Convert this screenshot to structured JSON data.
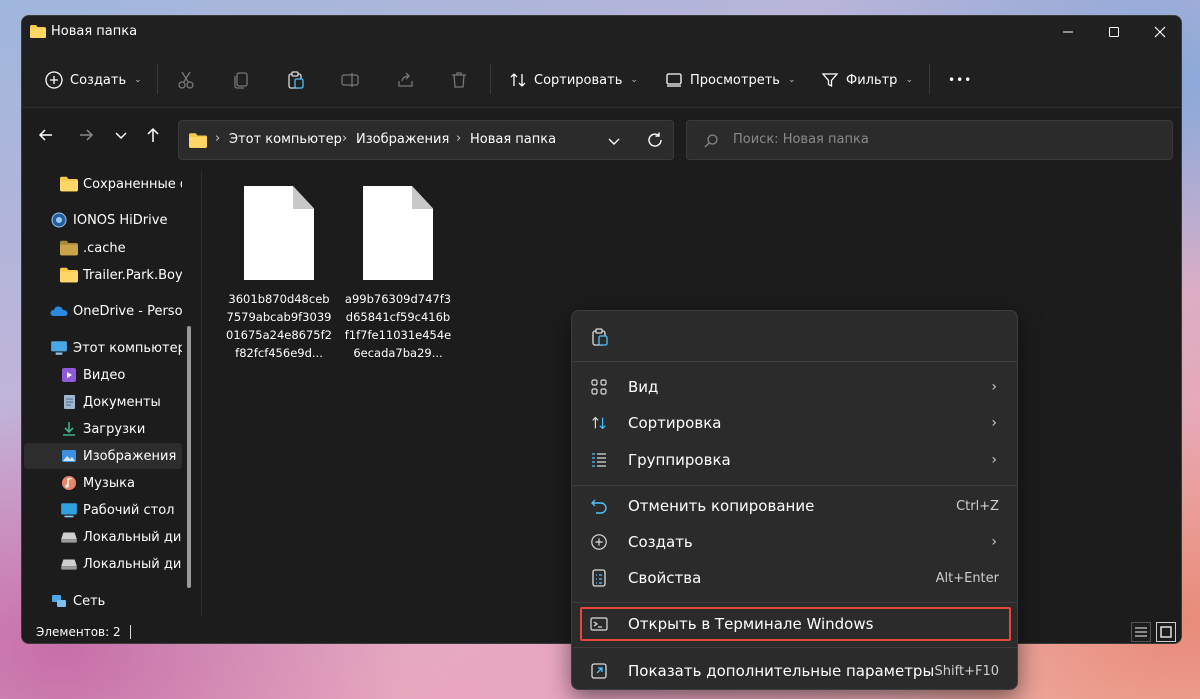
{
  "window": {
    "title": "Новая папка",
    "controls": {
      "minimize": "—",
      "maximize": "☐",
      "close": "✕"
    }
  },
  "toolbar": {
    "create_label": "Создать",
    "sort_label": "Сортировать",
    "view_label": "Просмотреть",
    "filter_label": "Фильтр",
    "more_label": "•••"
  },
  "address": {
    "crumbs": [
      "Этот компьютер",
      "Изображения",
      "Новая папка"
    ],
    "separator": "›"
  },
  "search": {
    "placeholder": "Поиск: Новая папка"
  },
  "sidebar": {
    "items": [
      {
        "label": "Сохраненные ф",
        "icon": "folder-icon"
      },
      {
        "label": "IONOS HiDrive",
        "icon": "cloud-drive-icon"
      },
      {
        "label": ".cache",
        "icon": "folder-icon"
      },
      {
        "label": "Trailer.Park.Boys",
        "icon": "folder-icon"
      },
      {
        "label": "OneDrive - Persor",
        "icon": "onedrive-icon"
      },
      {
        "label": "Этот компьютер",
        "icon": "computer-icon"
      },
      {
        "label": "Видео",
        "icon": "video-icon"
      },
      {
        "label": "Документы",
        "icon": "documents-icon"
      },
      {
        "label": "Загрузки",
        "icon": "download-icon"
      },
      {
        "label": "Изображения",
        "icon": "pictures-icon"
      },
      {
        "label": "Музыка",
        "icon": "music-icon"
      },
      {
        "label": "Рабочий стол",
        "icon": "desktop-icon"
      },
      {
        "label": "Локальный дис",
        "icon": "drive-icon"
      },
      {
        "label": "Локальный дис",
        "icon": "drive-icon"
      },
      {
        "label": "Сеть",
        "icon": "network-icon"
      }
    ],
    "selected_index": 9
  },
  "files": [
    {
      "name": "3601b870d48ceb7579abcab9f303901675a24e8675f2f82fcf456e9d..."
    },
    {
      "name": "a99b76309d747f3d65841cf59c416bf1f7fe11031e454e6ecada7ba29..."
    }
  ],
  "status": {
    "items_text": "Элементов: 2"
  },
  "context_menu": {
    "items": [
      {
        "label": "Вид",
        "shortcut": "",
        "submenu": true,
        "icon": "grid-view-icon"
      },
      {
        "label": "Сортировка",
        "shortcut": "",
        "submenu": true,
        "icon": "sort-icon"
      },
      {
        "label": "Группировка",
        "shortcut": "",
        "submenu": true,
        "icon": "group-icon"
      },
      {
        "label": "Отменить копирование",
        "shortcut": "Ctrl+Z",
        "submenu": false,
        "icon": "undo-icon"
      },
      {
        "label": "Создать",
        "shortcut": "",
        "submenu": true,
        "icon": "new-icon"
      },
      {
        "label": "Свойства",
        "shortcut": "Alt+Enter",
        "submenu": false,
        "icon": "properties-icon"
      },
      {
        "label": "Открыть в Терминале Windows",
        "shortcut": "",
        "submenu": false,
        "icon": "terminal-icon"
      },
      {
        "label": "Показать дополнительные параметры",
        "shortcut": "Shift+F10",
        "submenu": false,
        "icon": "more-options-icon"
      }
    ],
    "arrow": "›",
    "highlight_color": "#e8453c"
  },
  "colors": {
    "window_bg": "#1c1c1c",
    "menu_bg": "#2b2b2b",
    "accent_blue": "#4cc2ff",
    "folder_yellow": "#f6c84c"
  }
}
